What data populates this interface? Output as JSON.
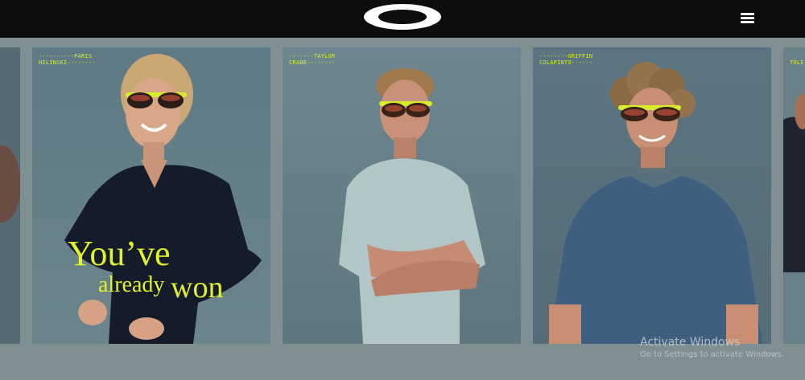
{
  "header": {
    "logo_name": "oakley-ellipse-logo",
    "menu_icon": "hamburger-menu-icon"
  },
  "carousel": {
    "panels": [
      {
        "first": "PARIS",
        "last": "HILINSKI",
        "slogan_line1": "You’ve",
        "slogan_line2a": "already",
        "slogan_line2b": "won"
      },
      {
        "first": "TAYLOR",
        "last": "CRABB"
      },
      {
        "first": "GRIFFIN",
        "last": "COLAPINTO"
      },
      {
        "first": "",
        "last": "TOLE"
      }
    ]
  },
  "os_overlay": {
    "title": "Activate Windows",
    "subtitle": "Go to Settings to activate Windows."
  },
  "colors": {
    "accent": "#e2f22a",
    "topbar": "#0d0d0d",
    "background": "#7e9094"
  }
}
